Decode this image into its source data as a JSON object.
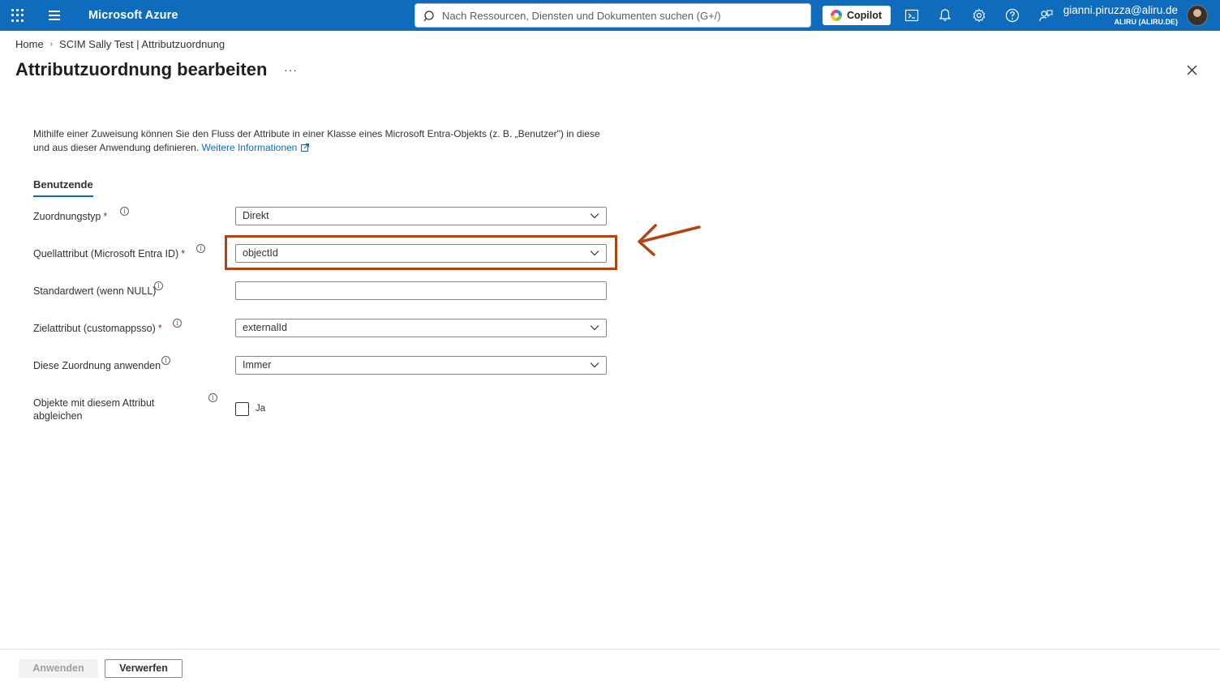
{
  "header": {
    "brand": "Microsoft Azure",
    "search_placeholder": "Nach Ressourcen, Diensten und Dokumenten suchen (G+/)",
    "copilot_label": "Copilot",
    "user_name": "gianni.piruzza@aliru.de",
    "user_tenant": "ALIRU (ALIRU.DE)",
    "icons": [
      "waffle-icon",
      "hamburger-icon",
      "search-icon",
      "cloud-shell-icon",
      "bell-icon",
      "gear-icon",
      "help-icon",
      "feedback-icon"
    ]
  },
  "breadcrumb": {
    "home": "Home",
    "current": "SCIM Sally Test | Attributzuordnung"
  },
  "page": {
    "title": "Attributzuordnung bearbeiten",
    "more": "···"
  },
  "description": {
    "text": "Mithilfe einer Zuweisung können Sie den Fluss der Attribute in einer Klasse eines Microsoft Entra-Objekts (z. B. „Benutzer\") in diese und aus dieser Anwendung definieren.",
    "link": "Weitere Informationen"
  },
  "tab": {
    "label": "Benutzende"
  },
  "form": {
    "mapping_type": {
      "label": "Zuordnungstyp",
      "required": "*",
      "value": "Direkt"
    },
    "source_attribute": {
      "label": "Quellattribut (Microsoft Entra ID)",
      "required": "*",
      "value": "objectId"
    },
    "default_value": {
      "label": "Standardwert (wenn NULL)",
      "value": ""
    },
    "target_attribute": {
      "label": "Zielattribut (customappsso)",
      "required": "*",
      "value": "externalId"
    },
    "apply_mapping": {
      "label": "Diese Zuordnung anwenden",
      "value": "Immer"
    },
    "match_objects": {
      "label_line1": "Objekte mit diesem Attribut",
      "label_line2": "abgleichen",
      "checkbox_label": "Ja",
      "checked": false
    }
  },
  "annotation": {
    "highlight_color": "#b5420f"
  },
  "footer": {
    "apply_label": "Anwenden",
    "discard_label": "Verwerfen"
  },
  "colors": {
    "topbar": "#0f6cbd",
    "link": "#0f6cbd",
    "required": "#a4262c"
  }
}
